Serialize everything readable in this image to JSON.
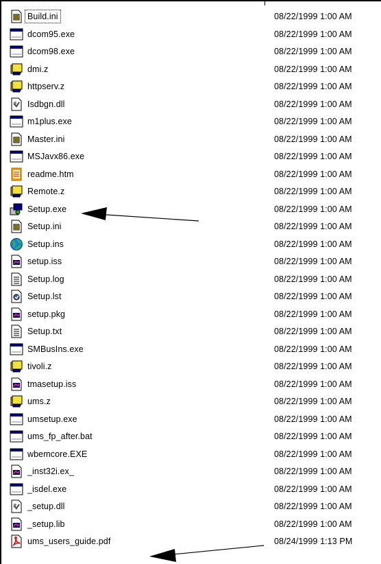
{
  "files": [
    {
      "name": "Build.ini",
      "date": "08/22/1999 1:00 AM",
      "icon": "ini-file-icon"
    },
    {
      "name": "dcom95.exe",
      "date": "08/22/1999 1:00 AM",
      "icon": "exe-window-icon"
    },
    {
      "name": "dcom98.exe",
      "date": "08/22/1999 1:00 AM",
      "icon": "exe-window-icon"
    },
    {
      "name": "dmi.z",
      "date": "08/22/1999 1:00 AM",
      "icon": "archive-z-icon"
    },
    {
      "name": "httpserv.z",
      "date": "08/22/1999 1:00 AM",
      "icon": "archive-z-icon"
    },
    {
      "name": "Isdbgn.dll",
      "date": "08/22/1999 1:00 AM",
      "icon": "dll-file-icon"
    },
    {
      "name": "m1plus.exe",
      "date": "08/22/1999 1:00 AM",
      "icon": "exe-window-icon"
    },
    {
      "name": "Master.ini",
      "date": "08/22/1999 1:00 AM",
      "icon": "ini-file-icon"
    },
    {
      "name": "MSJavx86.exe",
      "date": "08/22/1999 1:00 AM",
      "icon": "exe-window-icon"
    },
    {
      "name": "readme.htm",
      "date": "08/22/1999 1:00 AM",
      "icon": "htm-file-icon"
    },
    {
      "name": "Remote.z",
      "date": "08/22/1999 1:00 AM",
      "icon": "archive-z-icon"
    },
    {
      "name": "Setup.exe",
      "date": "08/22/1999 1:00 AM",
      "icon": "setup-exe-icon"
    },
    {
      "name": "Setup.ini",
      "date": "08/22/1999 1:00 AM",
      "icon": "ini-file-icon"
    },
    {
      "name": "Setup.ins",
      "date": "08/22/1999 1:00 AM",
      "icon": "globe-ins-icon"
    },
    {
      "name": "setup.iss",
      "date": "08/22/1999 1:00 AM",
      "icon": "iss-file-icon"
    },
    {
      "name": "Setup.log",
      "date": "08/22/1999 1:00 AM",
      "icon": "text-file-icon"
    },
    {
      "name": "Setup.lst",
      "date": "08/22/1999 1:00 AM",
      "icon": "lst-file-icon"
    },
    {
      "name": "setup.pkg",
      "date": "08/22/1999 1:00 AM",
      "icon": "iss-file-icon"
    },
    {
      "name": "Setup.txt",
      "date": "08/22/1999 1:00 AM",
      "icon": "text-file-icon"
    },
    {
      "name": "SMBusIns.exe",
      "date": "08/22/1999 1:00 AM",
      "icon": "exe-window-icon"
    },
    {
      "name": "tivoli.z",
      "date": "08/22/1999 1:00 AM",
      "icon": "archive-z-icon"
    },
    {
      "name": "tmasetup.iss",
      "date": "08/22/1999 1:00 AM",
      "icon": "iss-file-icon"
    },
    {
      "name": "ums.z",
      "date": "08/22/1999 1:00 AM",
      "icon": "archive-z-icon"
    },
    {
      "name": "umsetup.exe",
      "date": "08/22/1999 1:00 AM",
      "icon": "exe-window-icon"
    },
    {
      "name": "ums_fp_after.bat",
      "date": "08/22/1999 1:00 AM",
      "icon": "exe-window-icon"
    },
    {
      "name": "wbemcore.EXE",
      "date": "08/22/1999 1:00 AM",
      "icon": "exe-window-icon"
    },
    {
      "name": "_inst32i.ex_",
      "date": "08/22/1999 1:00 AM",
      "icon": "iss-file-icon"
    },
    {
      "name": "_isdel.exe",
      "date": "08/22/1999 1:00 AM",
      "icon": "exe-window-icon"
    },
    {
      "name": "_setup.dll",
      "date": "08/22/1999 1:00 AM",
      "icon": "dll-file-icon"
    },
    {
      "name": "_setup.lib",
      "date": "08/22/1999 1:00 AM",
      "icon": "iss-file-icon"
    },
    {
      "name": "ums_users_guide.pdf",
      "date": "08/24/1999 1:13 PM",
      "icon": "pdf-file-icon"
    }
  ],
  "colors": {
    "window_blue": "#000080",
    "folder_yellow": "#d8c000",
    "pdf_red": "#d01010",
    "htm_orange": "#f0a000"
  }
}
